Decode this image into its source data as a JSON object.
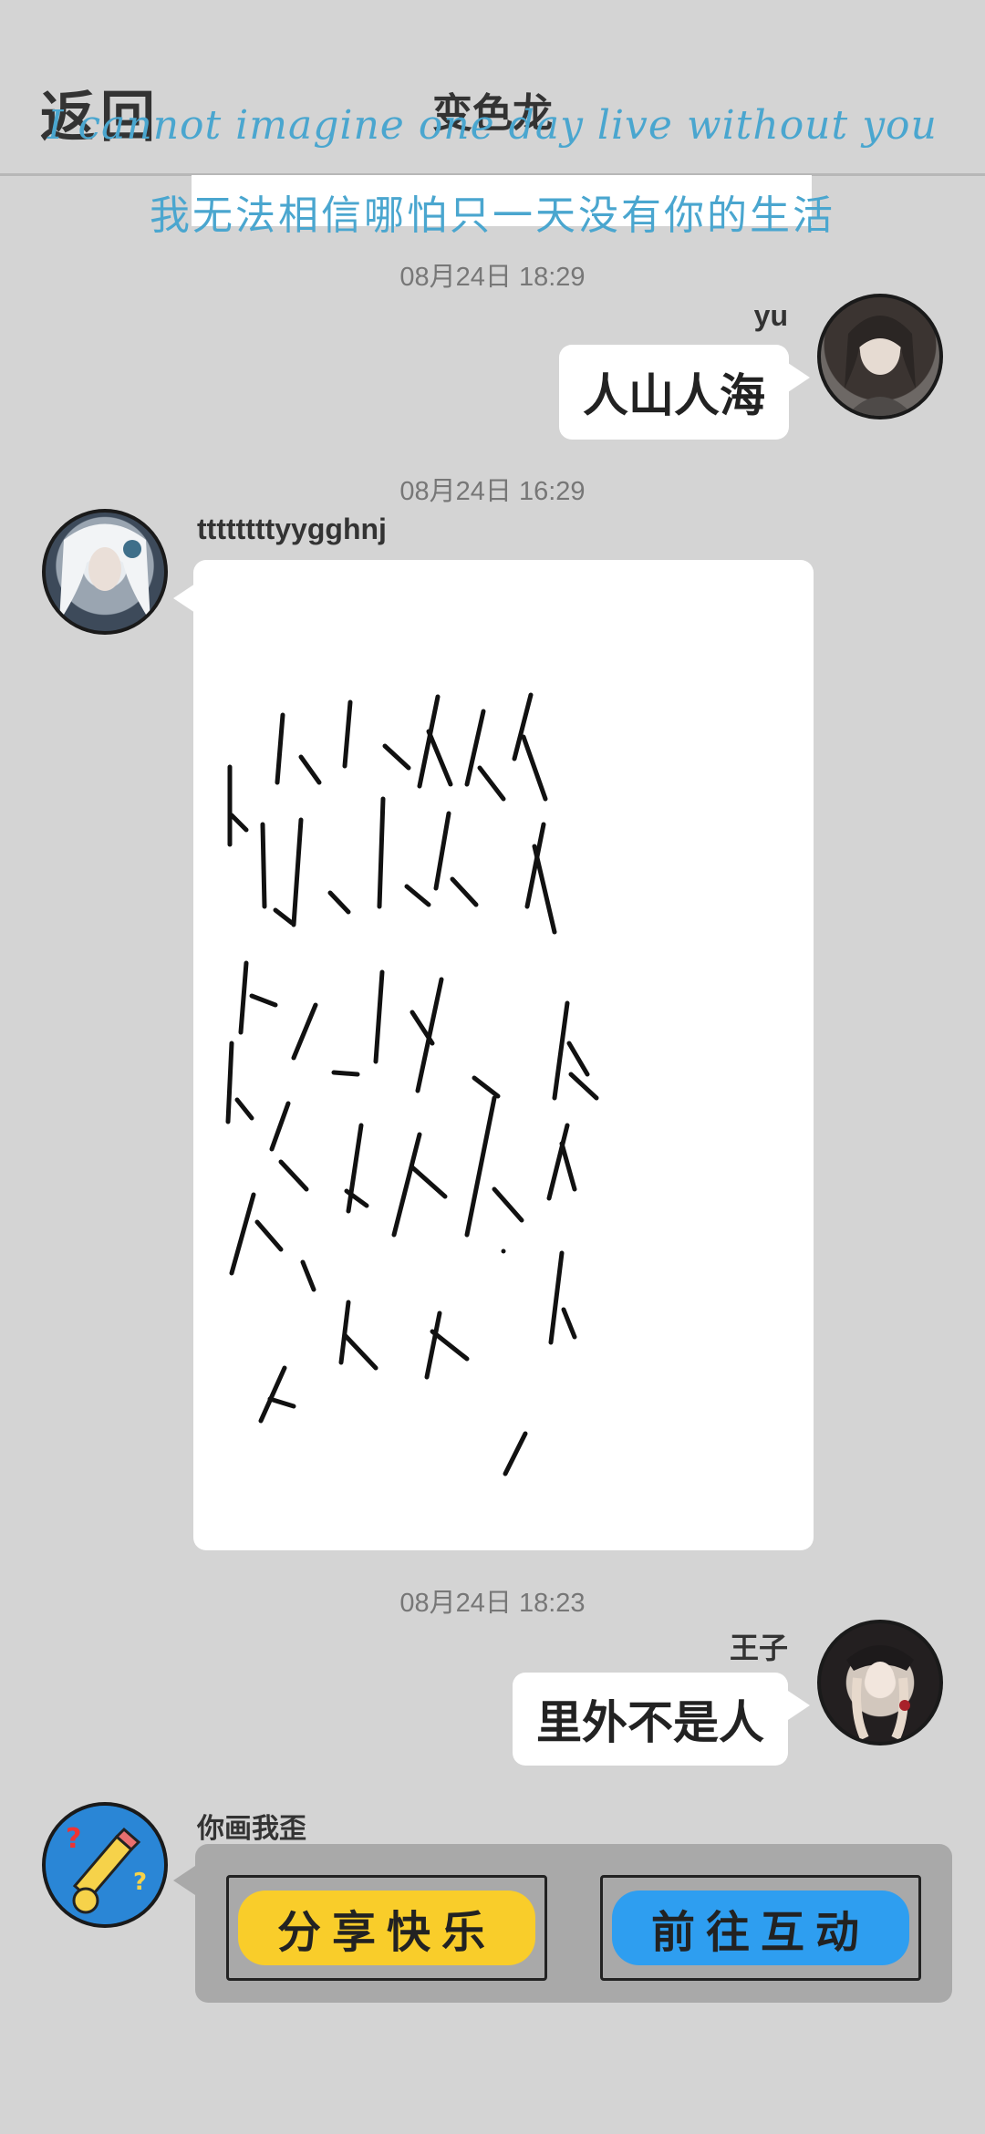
{
  "header": {
    "back_label": "返回",
    "title": "变色龙",
    "lyric_en": "I cannot imagine one day live without you",
    "lyric_zh": "我无法相信哪怕只一天没有你的生活"
  },
  "messages": [
    {
      "time": "08月24日  18:29",
      "sender": "yu",
      "side": "right",
      "text": "人山人海"
    },
    {
      "time": "08月24日  16:29",
      "sender": "ttttttttyygghnj",
      "side": "left",
      "content": "handwritten drawing"
    },
    {
      "time": "08月24日  18:23",
      "sender": "王子",
      "side": "right",
      "text": "里外不是人"
    },
    {
      "sender": "你画我歪",
      "side": "left",
      "buttons": [
        "分享快乐",
        "前往互动"
      ]
    }
  ],
  "colors": {
    "background": "#d4d4d4",
    "lyric": "#4aa6cf",
    "share_button": "#f9cd2a",
    "interact_button": "#2e9ef0"
  }
}
